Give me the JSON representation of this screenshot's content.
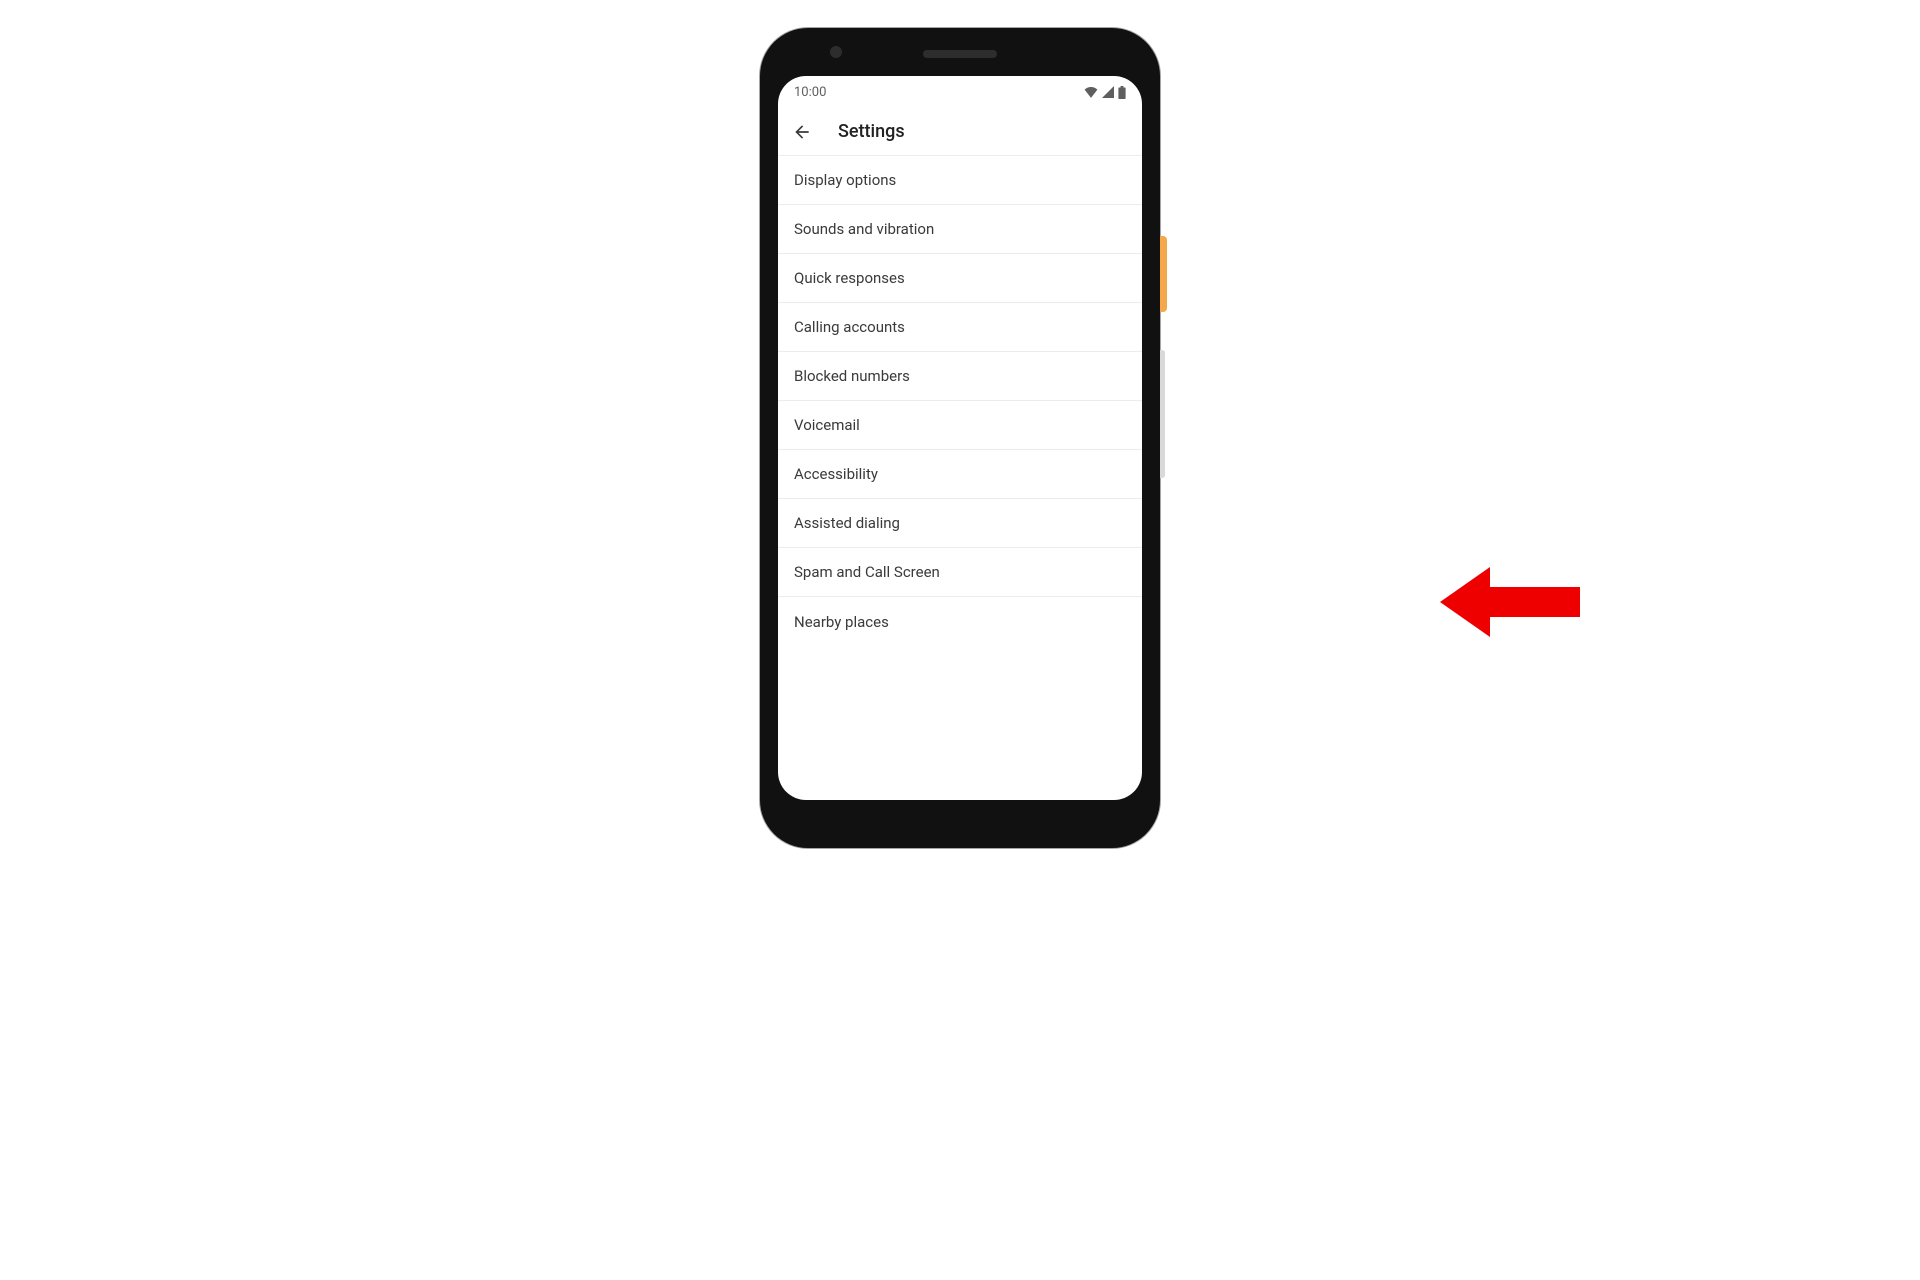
{
  "status": {
    "time": "10:00"
  },
  "header": {
    "title": "Settings"
  },
  "items": [
    "Display options",
    "Sounds and vibration",
    "Quick responses",
    "Calling accounts",
    "Blocked numbers",
    "Voicemail",
    "Accessibility",
    "Assisted dialing",
    "Spam and Call Screen",
    "Nearby places"
  ],
  "annotation": {
    "target_item_index": 8
  }
}
